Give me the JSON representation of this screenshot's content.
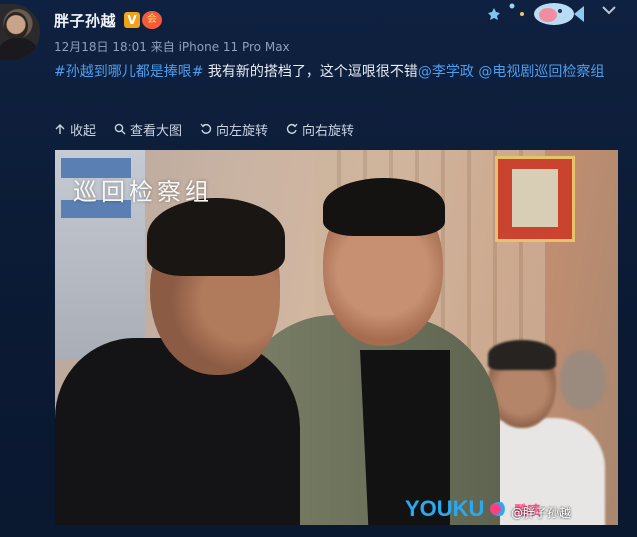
{
  "header": {
    "username": "胖子孙越",
    "verified_badge": "V",
    "member_badge": "会",
    "timestamp": "12月18日 18:01",
    "source": "来自 iPhone 11 Pro Max"
  },
  "post": {
    "hashtag": "#孙越到哪儿都是捧哏#",
    "text": " 我有新的搭档了，这个逗哏很不错",
    "mention1": "@李学政",
    "separator": " ",
    "mention2": "@电视剧巡回检察组"
  },
  "actions": [
    {
      "label": "收起",
      "icon": "collapse-arrow-icon"
    },
    {
      "label": "查看大图",
      "icon": "magnifier-icon"
    },
    {
      "label": "向左旋转",
      "icon": "rotate-left-icon"
    },
    {
      "label": "向右旋转",
      "icon": "rotate-right-icon"
    }
  ],
  "photo": {
    "title_overlay": "巡回检察组",
    "youku_logo": "YOUKU",
    "kuzhou_logo": "酷喷",
    "weibo_watermark": "@胖子孙越"
  },
  "colors": {
    "background": "#0e1a2e",
    "link": "#4e9ef0",
    "meta_text": "#8ea0bb",
    "youku_blue": "#2aa9f0"
  }
}
